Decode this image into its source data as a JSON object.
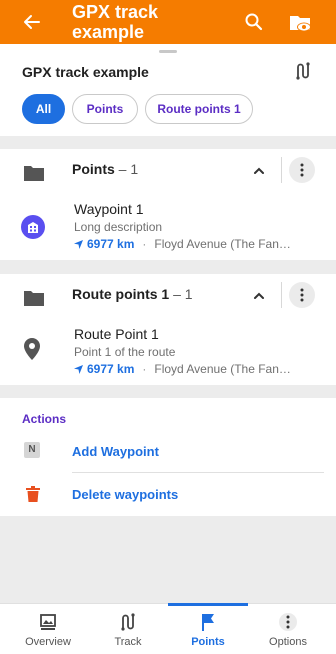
{
  "appbar": {
    "title": "GPX track example",
    "icons": [
      "back-arrow-icon",
      "search-icon",
      "folder-eye-icon"
    ]
  },
  "sheet": {
    "title": "GPX track example",
    "chips": [
      {
        "label": "All",
        "selected": true
      },
      {
        "label": "Points",
        "selected": false
      },
      {
        "label": "Route points 1",
        "selected": false
      }
    ]
  },
  "groups": [
    {
      "name": "Points",
      "count": "– 1",
      "item": {
        "name": "Waypoint 1",
        "description": "Long description",
        "distance": "6977 km",
        "separator": "·",
        "address": "Floyd Avenue (The Fan…"
      }
    },
    {
      "name": "Route points 1",
      "count": "– 1",
      "item": {
        "name": "Route Point 1",
        "description": "Point 1 of the route",
        "distance": "6977 km",
        "separator": "·",
        "address": "Floyd Avenue (The Fan…"
      }
    }
  ],
  "actions": {
    "header": "Actions",
    "items": [
      {
        "label": "Add Waypoint",
        "icon": "n-icon"
      },
      {
        "label": "Delete waypoints",
        "icon": "trash-icon"
      }
    ]
  },
  "bottom_nav": [
    {
      "label": "Overview",
      "active": false
    },
    {
      "label": "Track",
      "active": false
    },
    {
      "label": "Points",
      "active": true
    },
    {
      "label": "Options",
      "active": false
    }
  ],
  "colors": {
    "appbar": "#f57c00",
    "accent": "#1e6fe0",
    "purple": "#5b2dc4",
    "waypoint_icon": "#5a4ff0",
    "trash": "#e8501f"
  }
}
